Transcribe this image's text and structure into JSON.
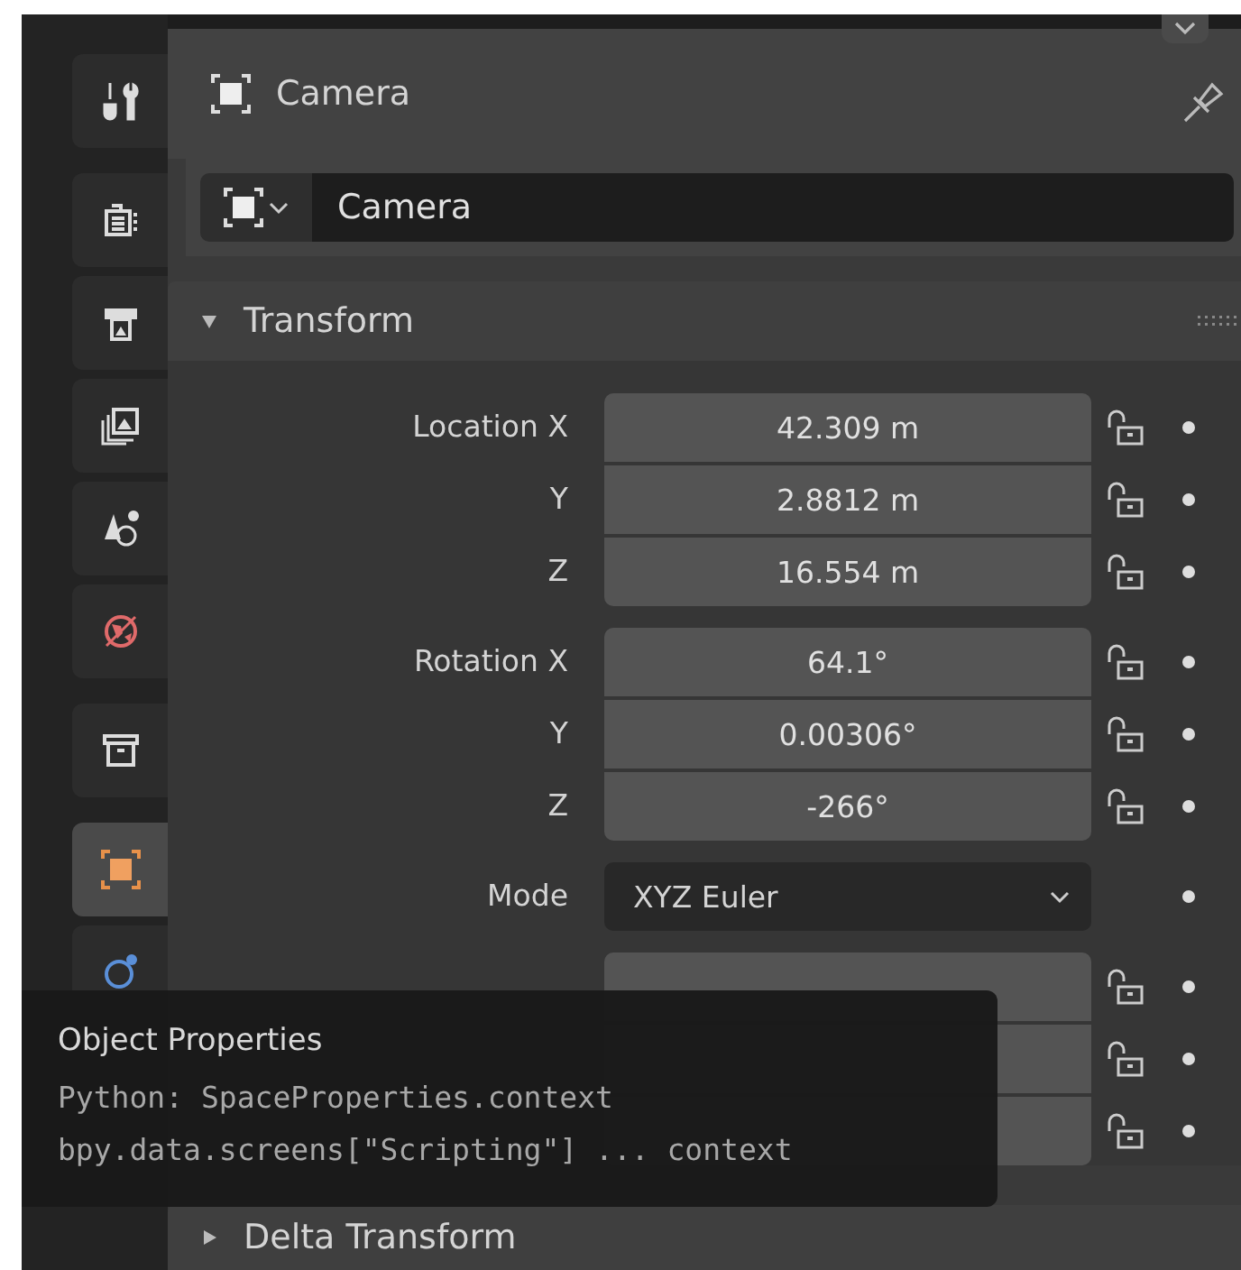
{
  "sidebar": {
    "groups": [
      [
        {
          "kind": "tool",
          "selected": false
        }
      ],
      [
        {
          "kind": "render",
          "selected": false
        },
        {
          "kind": "output",
          "selected": false
        },
        {
          "kind": "view_layer",
          "selected": false
        },
        {
          "kind": "scene",
          "selected": false
        },
        {
          "kind": "world",
          "selected": false
        }
      ],
      [
        {
          "kind": "collection",
          "selected": false
        }
      ],
      [
        {
          "kind": "object",
          "selected": true
        },
        {
          "kind": "modifiers",
          "selected": false
        }
      ]
    ]
  },
  "header": {
    "title": "Camera"
  },
  "object_name": {
    "value": "Camera"
  },
  "panels": [
    {
      "title": "Transform",
      "expanded": true,
      "groups": [
        {
          "rows": [
            {
              "kind": "number",
              "label": "Location X",
              "value": "42.309 m",
              "locked": false
            },
            {
              "kind": "number",
              "label": "Y",
              "value": "2.8812 m",
              "locked": false
            },
            {
              "kind": "number",
              "label": "Z",
              "value": "16.554 m",
              "locked": false
            }
          ]
        },
        {
          "rows": [
            {
              "kind": "number",
              "label": "Rotation X",
              "value": "64.1°",
              "locked": false
            },
            {
              "kind": "number",
              "label": "Y",
              "value": "0.00306°",
              "locked": false
            },
            {
              "kind": "number",
              "label": "Z",
              "value": "-266°",
              "locked": false
            }
          ]
        },
        {
          "rows": [
            {
              "kind": "dropdown",
              "label": "Mode",
              "value": "XYZ Euler"
            }
          ]
        },
        {
          "rows": [
            {
              "kind": "number",
              "locked": false
            },
            {
              "kind": "number",
              "locked": false
            },
            {
              "kind": "number",
              "locked": false
            }
          ]
        }
      ]
    },
    {
      "title": "Delta Transform",
      "expanded": false
    }
  ],
  "tooltip": {
    "title": "Object Properties",
    "lines": [
      "Python: SpaceProperties.context",
      "bpy.data.screens[\"Scripting\"] ... context"
    ]
  }
}
